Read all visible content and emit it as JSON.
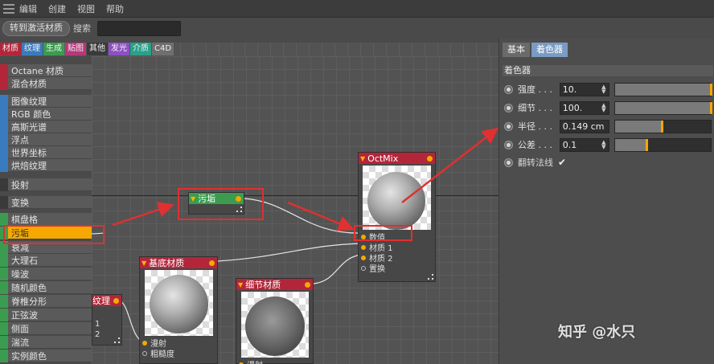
{
  "menu": [
    "编辑",
    "创建",
    "视图",
    "帮助"
  ],
  "toolbar": {
    "activate_label": "转到激活材质",
    "search_label": "搜索",
    "search_value": ""
  },
  "categories": [
    {
      "label": "材质",
      "color": "#b3263a"
    },
    {
      "label": "纹理",
      "color": "#3a7bbf"
    },
    {
      "label": "生成",
      "color": "#3b9c4f"
    },
    {
      "label": "贴图",
      "color": "#b8377a"
    },
    {
      "label": "其他",
      "color": "#3a3a3a"
    },
    {
      "label": "发光",
      "color": "#8f4fc4"
    },
    {
      "label": "介质",
      "color": "#2aa08a"
    },
    {
      "label": "C4D",
      "color": "#6f6f6f"
    }
  ],
  "node_list": [
    {
      "label": "Octane 材质",
      "color": "#b3263a"
    },
    {
      "label": "混合材质",
      "color": "#b3263a"
    },
    {
      "label": "图像纹理",
      "color": "#3a7bbf"
    },
    {
      "label": "RGB 颜色",
      "color": "#3a7bbf"
    },
    {
      "label": "高斯光谱",
      "color": "#3a7bbf"
    },
    {
      "label": "浮点",
      "color": "#3a7bbf"
    },
    {
      "label": "世界坐标",
      "color": "#3a7bbf"
    },
    {
      "label": "烘焙纹理",
      "color": "#3a7bbf"
    },
    {
      "label": "投射",
      "color": "#3a3a3a"
    },
    {
      "label": "变换",
      "color": "#3a3a3a"
    },
    {
      "label": "棋盘格",
      "color": "#3b9c4f"
    },
    {
      "label": "污垢",
      "color": "#3b9c4f"
    },
    {
      "label": "衰减",
      "color": "#3b9c4f"
    },
    {
      "label": "大理石",
      "color": "#3b9c4f"
    },
    {
      "label": "噪波",
      "color": "#3b9c4f"
    },
    {
      "label": "随机颜色",
      "color": "#3b9c4f"
    },
    {
      "label": "脊椎分形",
      "color": "#3b9c4f"
    },
    {
      "label": "正弦波",
      "color": "#3b9c4f"
    },
    {
      "label": "侧面",
      "color": "#3b9c4f"
    },
    {
      "label": "湍流",
      "color": "#3b9c4f"
    },
    {
      "label": "实例颜色",
      "color": "#3b9c4f"
    }
  ],
  "selected_node": "污垢",
  "nodes": {
    "dirt": {
      "title": "污垢",
      "header_color": "#3b9c4f"
    },
    "octmix": {
      "title": "OctMix",
      "header_color": "#b3263a",
      "ports": [
        "数值",
        "材质 1",
        "材质 2",
        "置换"
      ]
    },
    "base": {
      "title": "基底材质",
      "header_color": "#b3263a",
      "ports": [
        "漫射",
        "粗糙度"
      ]
    },
    "detail": {
      "title": "细节材质",
      "header_color": "#b3263a",
      "ports": [
        "漫射"
      ]
    },
    "texture": {
      "title": "纹理",
      "header_color": "#b3263a",
      "ports": [
        "1",
        "2"
      ]
    }
  },
  "right_panel": {
    "tabs": [
      "基本",
      "着色器"
    ],
    "active_tab": "着色器",
    "section_title": "着色器",
    "params": [
      {
        "label": "强度 . . .",
        "value": "10.",
        "fill": 1.0
      },
      {
        "label": "细节 . . .",
        "value": "100.",
        "fill": 1.0
      },
      {
        "label": "半径 . . .",
        "value": "0.149 cm",
        "fill": 0.47
      },
      {
        "label": "公差 . . .",
        "value": "0.1",
        "fill": 0.32
      }
    ],
    "invert_label": "翻转法线",
    "invert_checked": "✔"
  },
  "watermark": "知乎 @水只"
}
